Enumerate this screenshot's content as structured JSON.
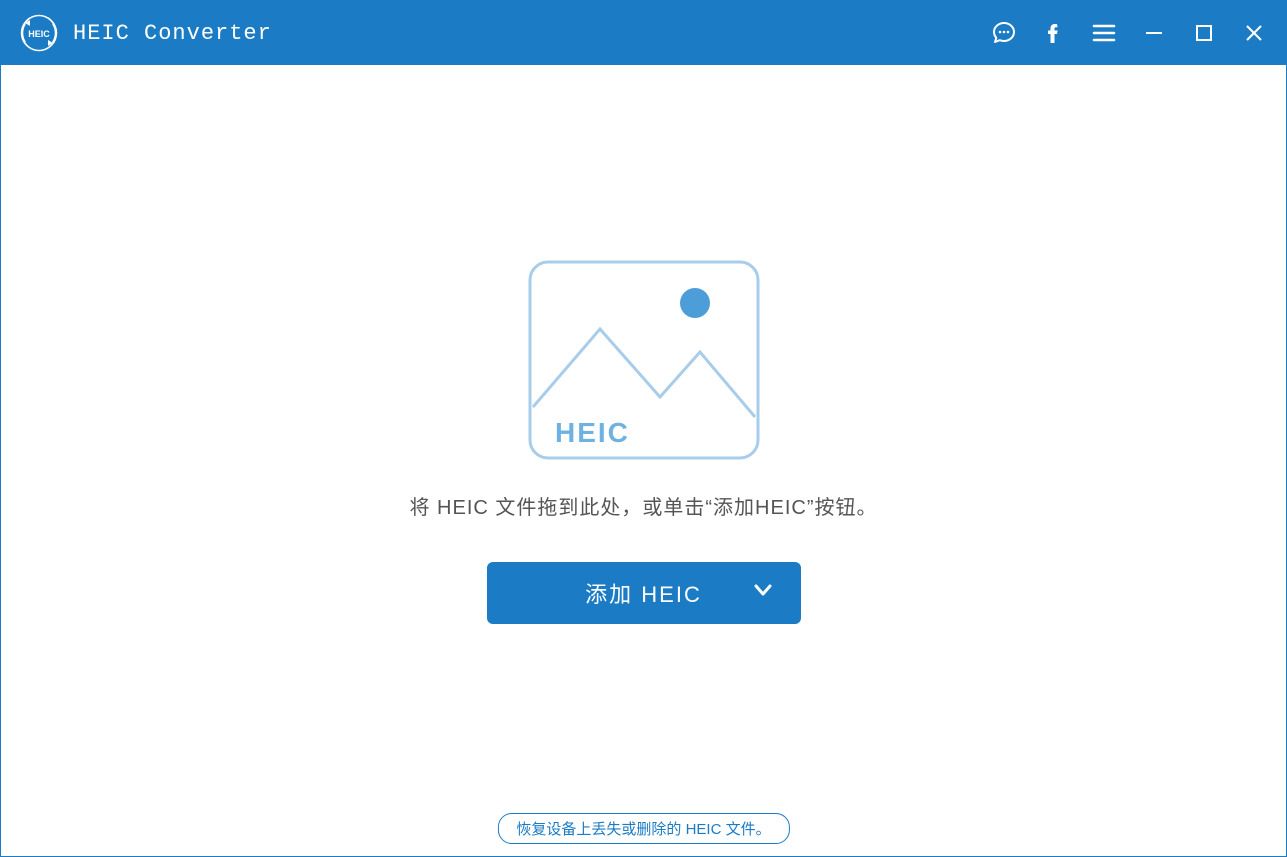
{
  "app": {
    "title": "HEIC Converter",
    "logo_text": "HEIC"
  },
  "main": {
    "illustration_label": "HEIC",
    "instruction": "将 HEIC 文件拖到此处，或单击“添加HEIC”按钮。",
    "add_button_label": "添加 HEIC"
  },
  "footer": {
    "recover_link": "恢复设备上丢失或删除的 HEIC 文件。"
  },
  "colors": {
    "brand": "#1b7bc4",
    "illustration_stroke": "#a7cdea",
    "illustration_fill": "#4d9ed8"
  }
}
